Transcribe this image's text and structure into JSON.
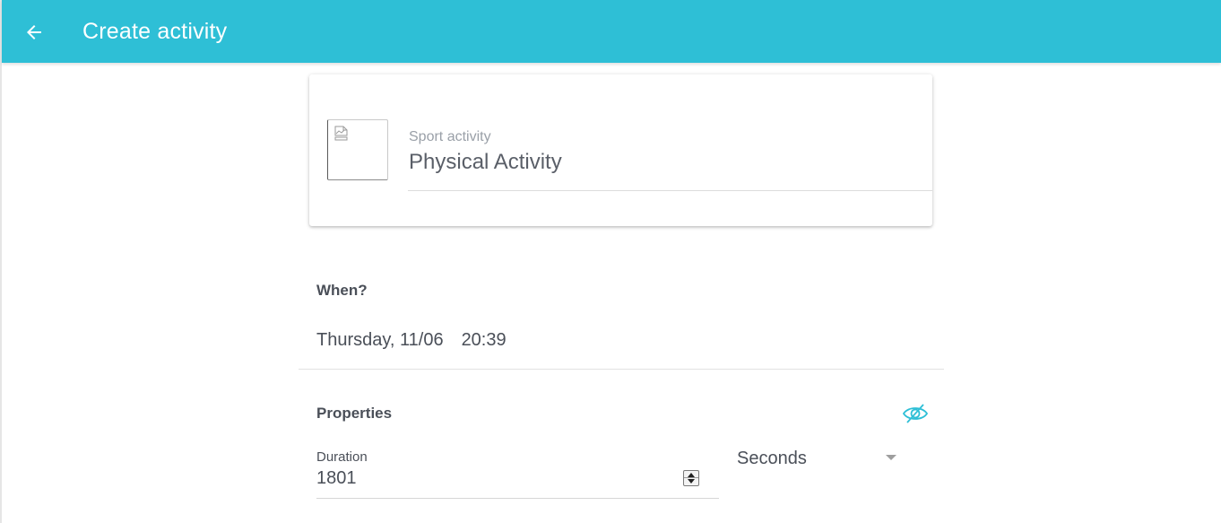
{
  "appbar": {
    "title": "Create activity",
    "back_icon": "arrow-left-icon",
    "color": "#2ebfd6"
  },
  "activity_card": {
    "image_icon": "broken-image-icon",
    "category": "Sport activity",
    "name": "Physical Activity"
  },
  "when": {
    "heading": "When?",
    "date": "Thursday, 11/06",
    "time": "20:39"
  },
  "properties": {
    "heading": "Properties",
    "visibility_icon": "eye-off-icon",
    "accent_color": "#2ebfd6",
    "duration": {
      "label": "Duration",
      "value": "1801"
    },
    "unit": {
      "selected": "Seconds"
    }
  }
}
